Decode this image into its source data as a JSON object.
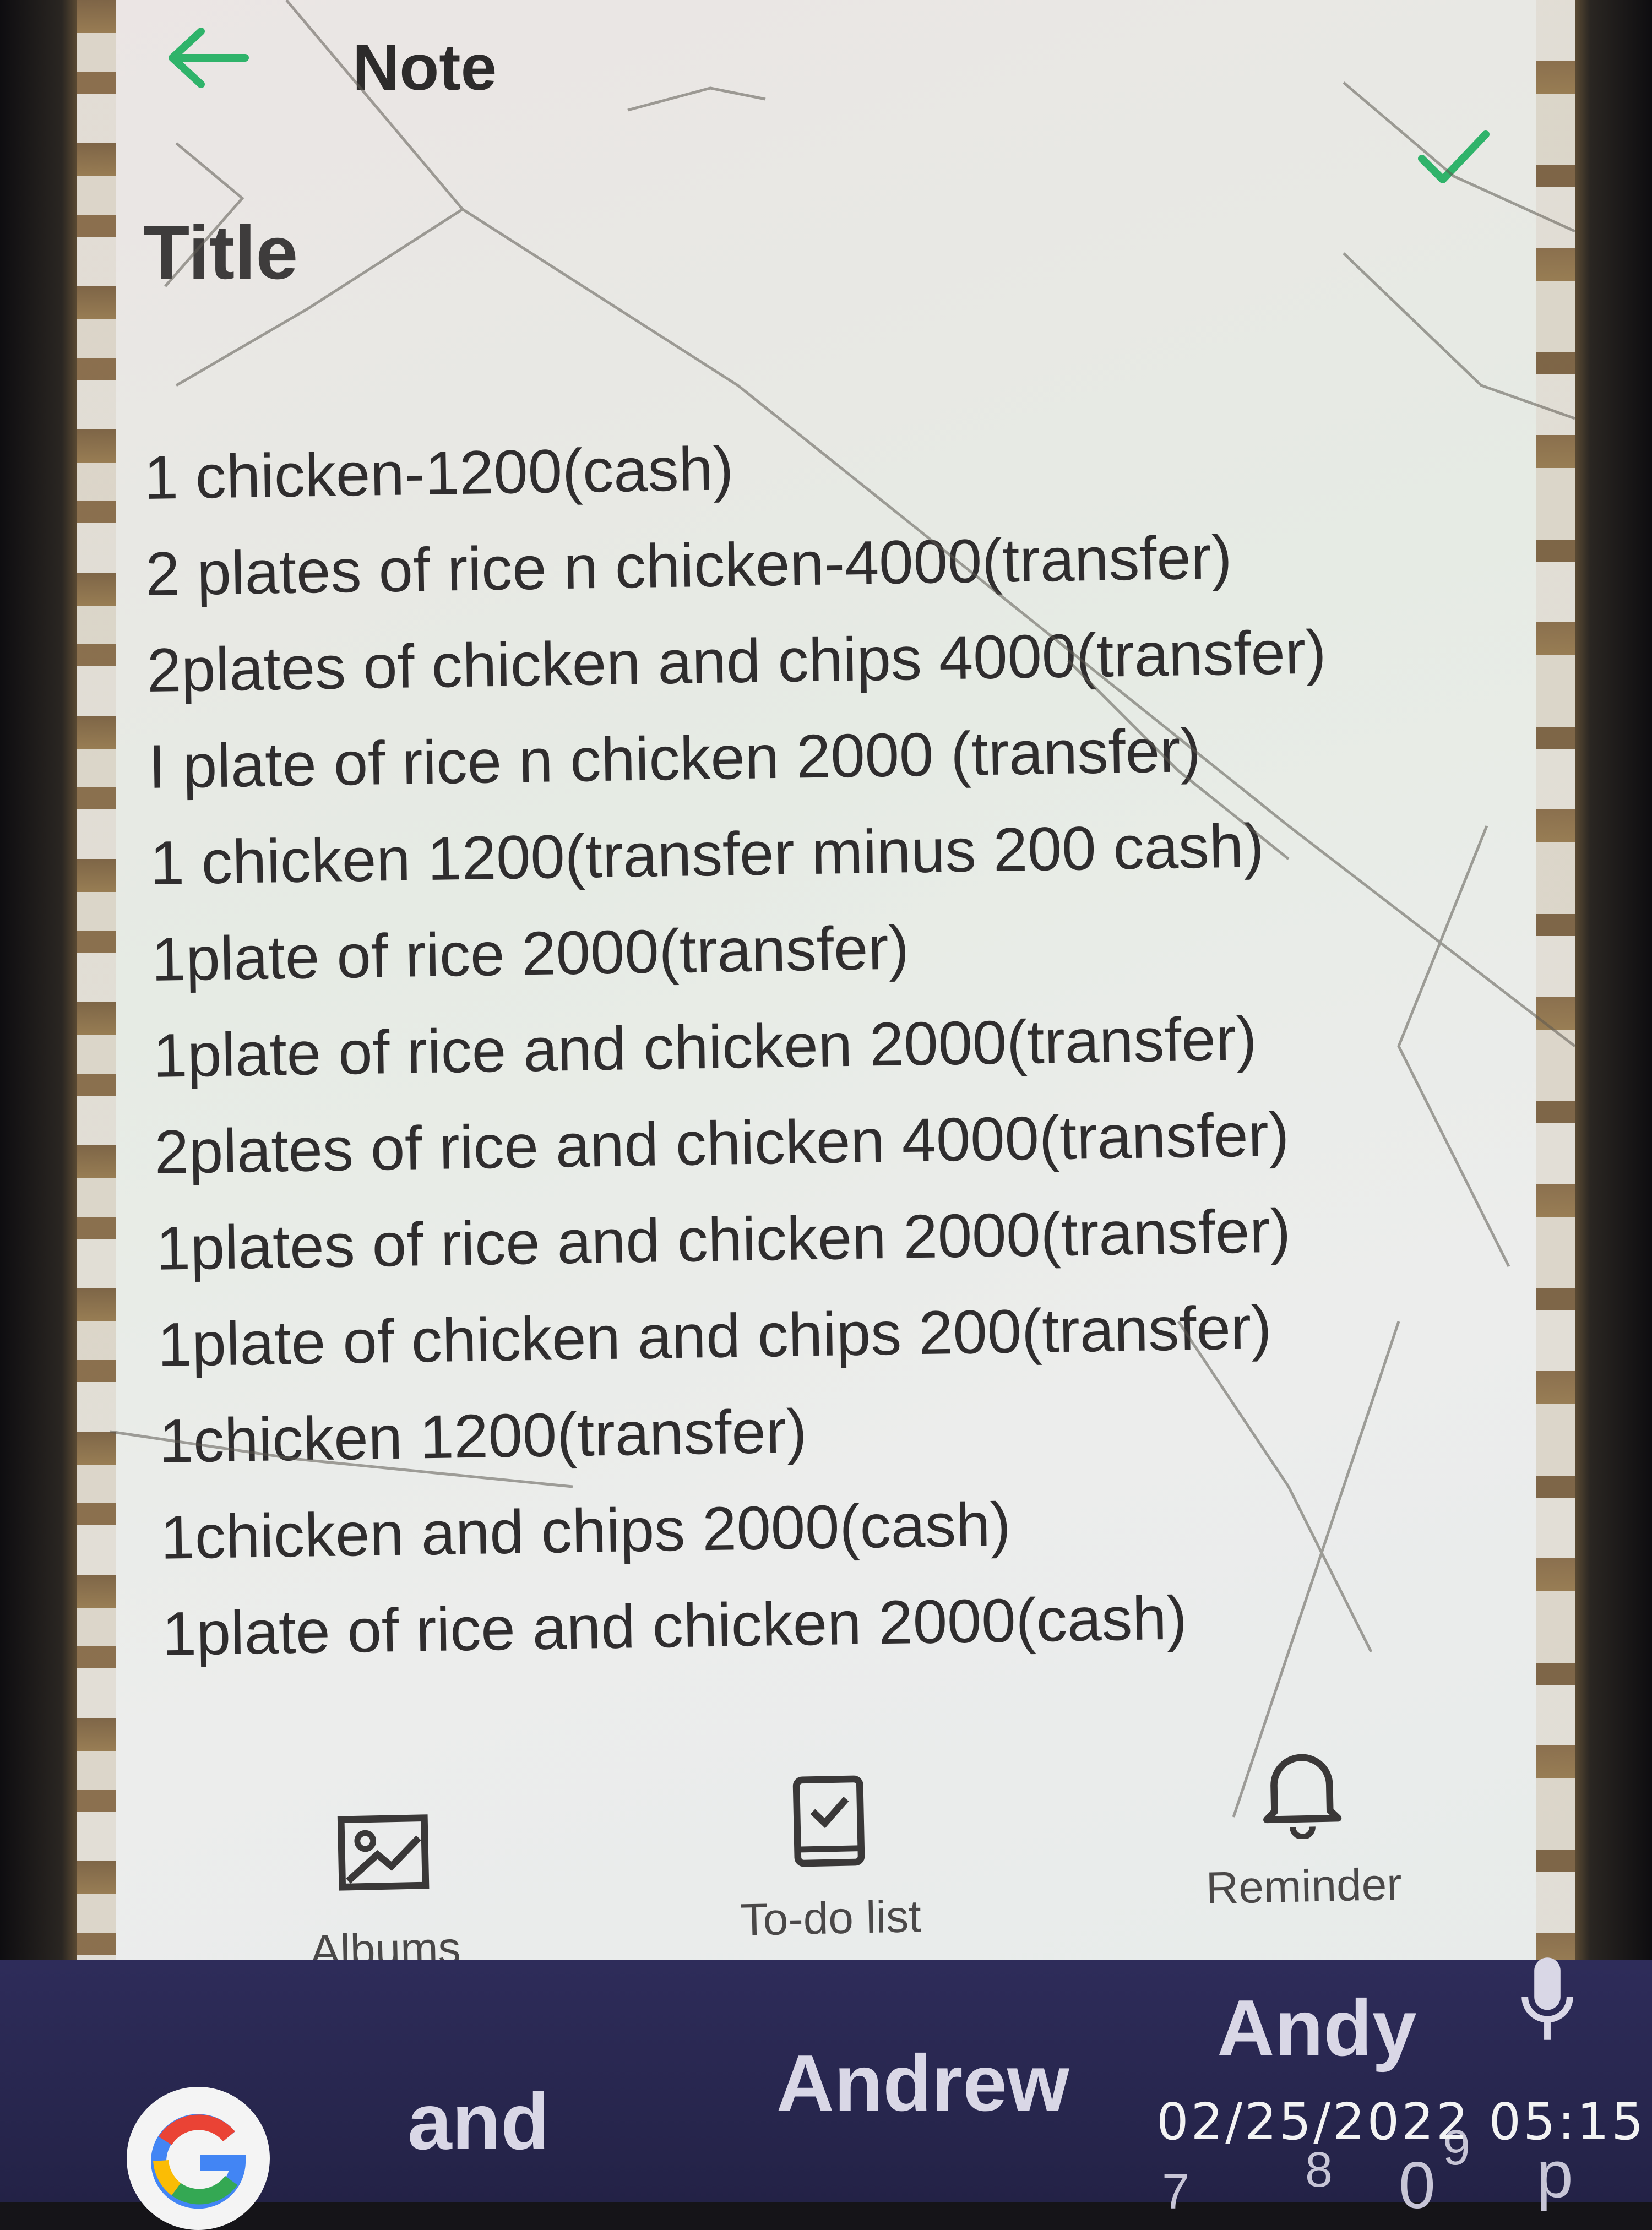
{
  "header": {
    "title": "Note",
    "back_icon": "back-arrow-icon",
    "confirm_icon": "checkmark-icon",
    "accent_color": "#2fb36a"
  },
  "note": {
    "title_placeholder": "Title",
    "lines": [
      "1 chicken-1200(cash)",
      "2 plates of rice n chicken-4000(transfer)",
      "2plates of chicken and chips 4000(transfer)",
      "I plate of rice n chicken 2000 (transfer)",
      "1 chicken 1200(transfer minus 200 cash)",
      "1plate of rice 2000(transfer)",
      "1plate of rice and chicken 2000(transfer)",
      "2plates of rice and chicken 4000(transfer)",
      "1plates of rice and chicken 2000(transfer)",
      "1plate of chicken and chips 200(transfer)",
      "1chicken 1200(transfer)",
      "1chicken and chips 2000(cash)",
      "1plate of rice and chicken 2000(cash)"
    ]
  },
  "toolbar": {
    "albums_label": "Albums",
    "todo_label": "To-do list",
    "reminder_label": "Reminder"
  },
  "keyboard": {
    "suggestions": [
      "and",
      "Andrew",
      "Andy"
    ],
    "key_hints": [
      "7",
      "8",
      "9",
      "0",
      "p"
    ],
    "google_icon": "google-g-icon",
    "mic_icon": "microphone-icon"
  },
  "camera": {
    "timestamp": "02/25/2022  05:15"
  }
}
